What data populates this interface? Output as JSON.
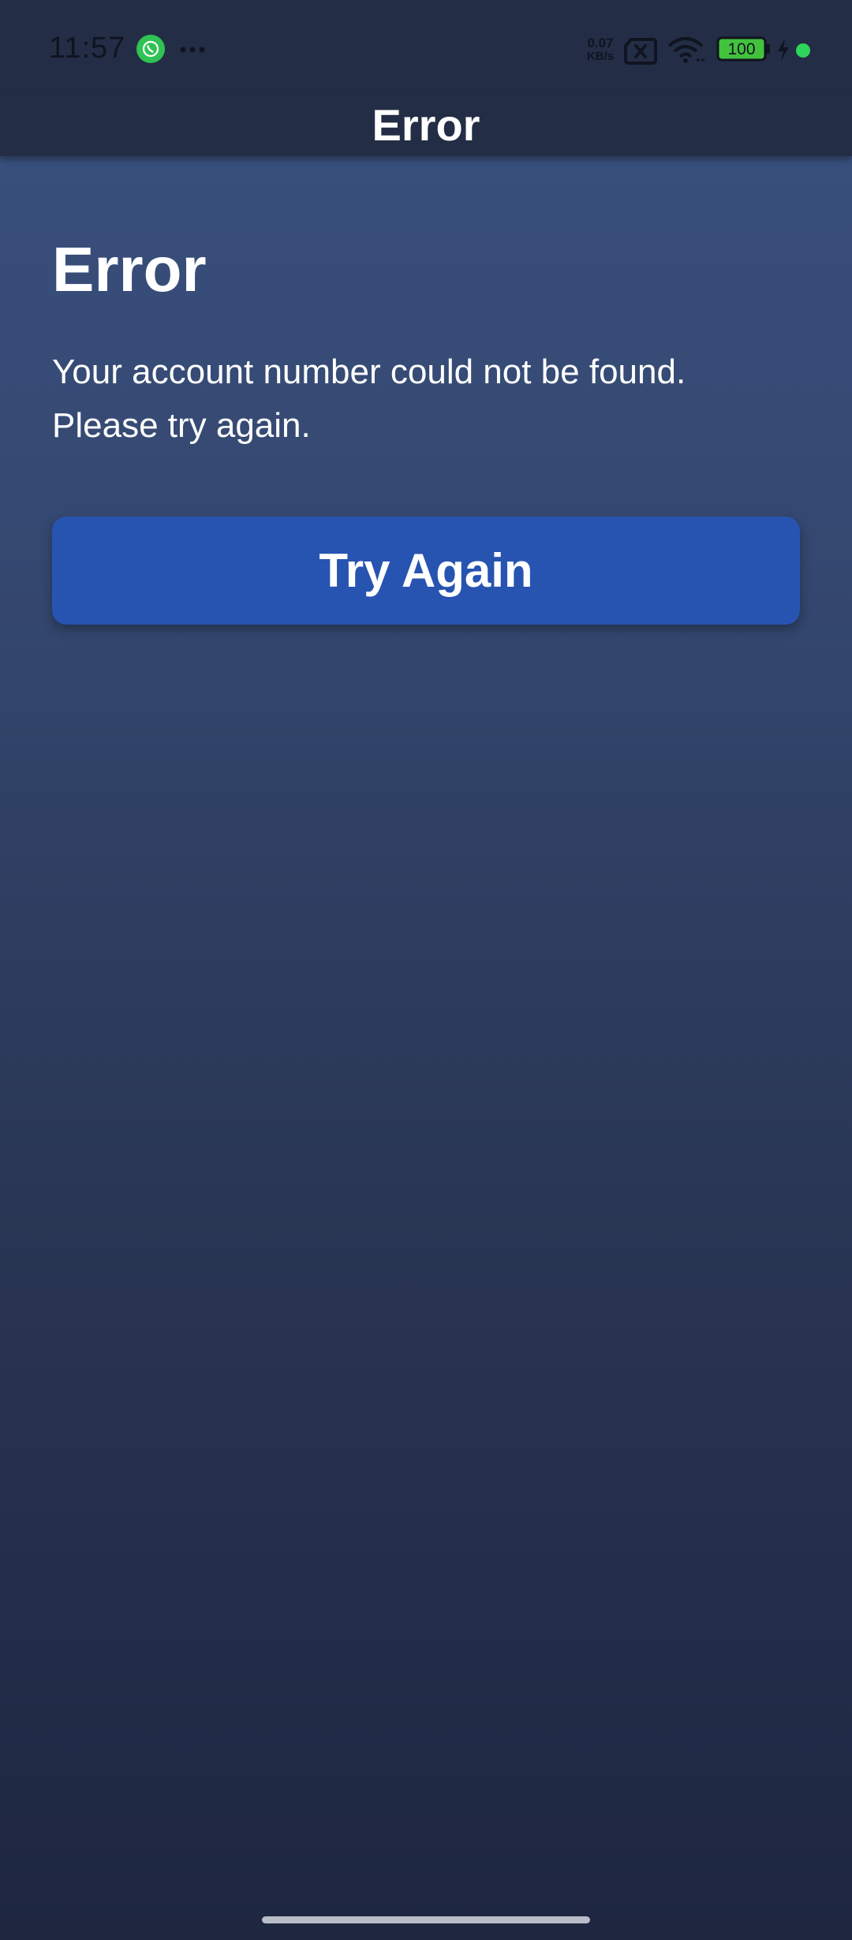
{
  "status_bar": {
    "time": "11:57",
    "net_speed_value": "0.07",
    "net_speed_unit": "KB/s",
    "battery_level": "100",
    "icons": [
      "whatsapp-icon",
      "more-dots-icon",
      "sim-icon",
      "wifi-icon",
      "battery-icon",
      "bolt-icon",
      "green-dot"
    ]
  },
  "app_bar": {
    "title": "Error"
  },
  "main": {
    "heading": "Error",
    "message_line1": "Your account number could not be found.",
    "message_line2": "Please try again.",
    "button_label": "Try Again"
  },
  "colors": {
    "button": "#2754b0",
    "app_bar": "#232d45",
    "background_top": "#3a5280",
    "background_bottom": "#1e2640",
    "status_dot": "#2fd45a"
  }
}
